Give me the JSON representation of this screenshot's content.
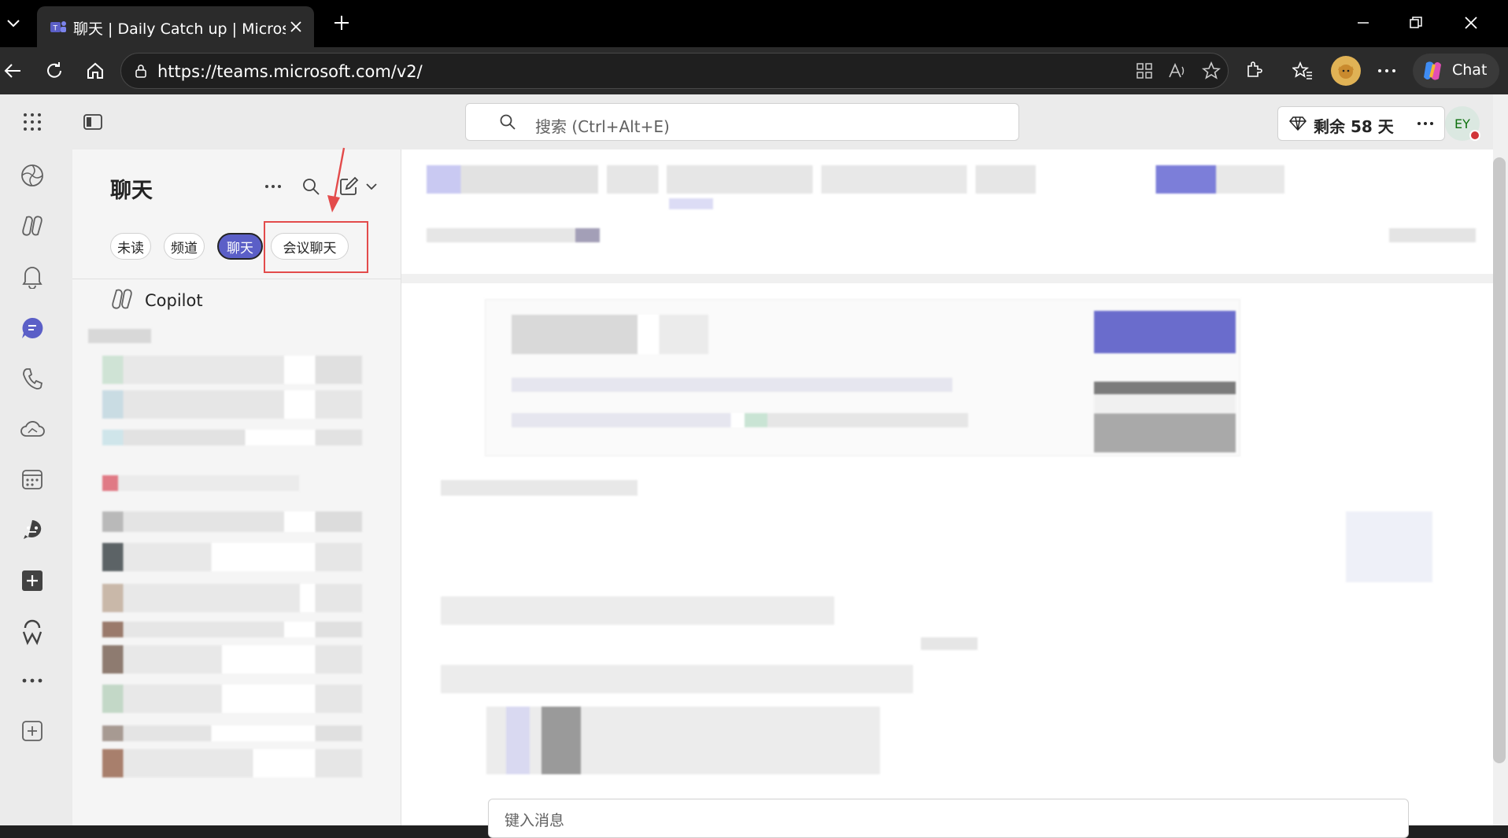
{
  "browser": {
    "tab_title": "聊天 | Daily Catch up | Microsoft Teams",
    "url": "https://teams.microsoft.com/v2/",
    "chat_button_label": "Chat"
  },
  "teams": {
    "search_placeholder": "搜索 (Ctrl+Alt+E)",
    "trial_label": "剩余 58 天",
    "avatar_initials": "EY",
    "chat_pane": {
      "title": "聊天",
      "filters": [
        "未读",
        "频道",
        "聊天",
        "会议聊天"
      ],
      "active_filter": "聊天",
      "copilot_label": "Copilot"
    },
    "composer_placeholder": "键入消息"
  },
  "colors": {
    "accent": "#5b5fc7",
    "highlight": "#e34b4b",
    "presence_busy": "#d13438"
  }
}
